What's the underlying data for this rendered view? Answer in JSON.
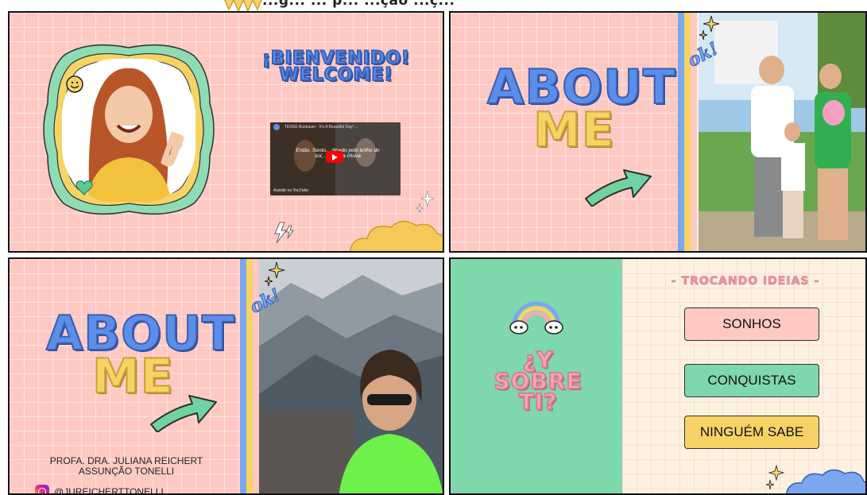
{
  "header": {
    "partial_text": "...g... ... p... ...ção ...ç..."
  },
  "slide1": {
    "welcome_lines": [
      "¡BIENVENIDO!",
      "WELCOME!"
    ],
    "video": {
      "title": "TENSE Busbauer - It's A Beautiful Day! ...",
      "caption": "Então, Sento... dipado pelo brilho do sol, ...do pela chuva",
      "footer": "Assistir no YouTube"
    }
  },
  "slide2": {
    "about": "ABOUT",
    "me": "ME",
    "ok": "ok!"
  },
  "slide3": {
    "about": "ABOUT",
    "me": "ME",
    "ok": "ok!",
    "name_line1": "PROFA. DRA. JULIANA REICHERT",
    "name_line2": "ASSUNÇÃO TONELLI",
    "instagram": "@JUREICHERTTONELLI"
  },
  "slide4": {
    "sobre": [
      "¿Y",
      "SOBRE",
      "TI?"
    ],
    "trocando": "- TROCANDO IDEIAS -",
    "options": [
      "SONHOS",
      "CONQUISTAS",
      "NINGUÉM SABE"
    ]
  },
  "colors": {
    "pink_bg": "#ffc9c3",
    "green_panel": "#7fd7ac",
    "yellow": "#f6d364",
    "blue": "#5b8ee8",
    "cream": "#fdf1e1"
  },
  "icons": [
    "sun-icon",
    "smiley-icon",
    "heart-icon",
    "sparkle-icon",
    "lightning-icon",
    "cloud-icon",
    "arrow-icon",
    "rainbow-icon",
    "instagram-icon",
    "play-icon"
  ]
}
